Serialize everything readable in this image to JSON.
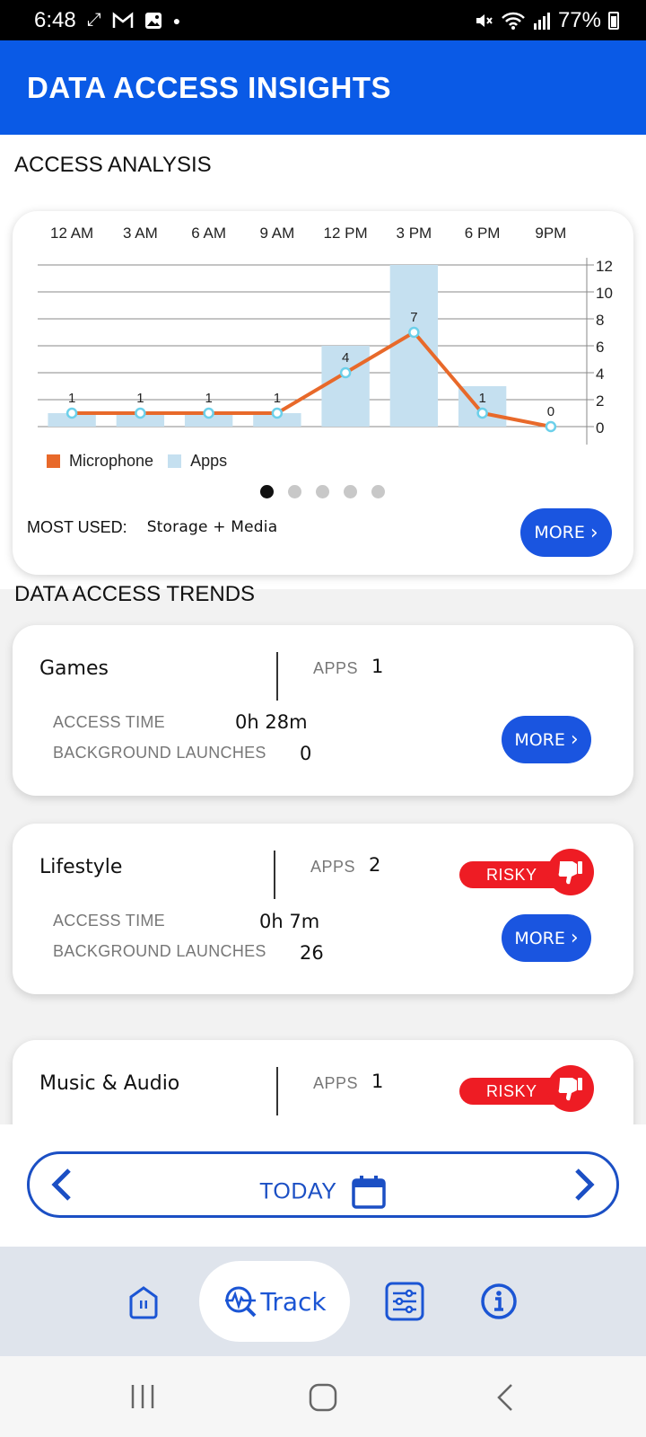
{
  "status_bar": {
    "time": "6:48",
    "battery": "77%",
    "left_icons": [
      "sync-icon",
      "gmail-icon",
      "image-icon",
      "dot-icon"
    ],
    "right_icons": [
      "mute-icon",
      "wifi-icon",
      "signal-icon",
      "battery-icon"
    ]
  },
  "header": {
    "title": "DATA ACCESS INSIGHTS",
    "color": "#0a5ae6"
  },
  "access_analysis": {
    "section_title": "ACCESS ANALYSIS",
    "most_used_label": "MOST USED:",
    "most_used_value": "Storage + Media",
    "more_label": "MORE",
    "legend": [
      {
        "label": "Microphone",
        "color": "#e8692a"
      },
      {
        "label": "Apps",
        "color": "#c5e0f0"
      }
    ],
    "pager": {
      "count": 5,
      "active": 0
    }
  },
  "chart_data": {
    "type": "bar",
    "categories": [
      "12 AM",
      "3 AM",
      "6 AM",
      "9 AM",
      "12 PM",
      "3 PM",
      "6 PM",
      "9PM"
    ],
    "series": [
      {
        "name": "Apps",
        "type": "bar",
        "values": [
          1,
          1,
          1,
          1,
          6,
          12,
          3,
          0
        ]
      },
      {
        "name": "Microphone",
        "type": "line",
        "values": [
          1,
          1,
          1,
          1,
          4,
          7,
          1,
          0
        ]
      }
    ],
    "data_labels": [
      "1",
      "1",
      "1",
      "1",
      "4",
      "7",
      "1",
      "0"
    ],
    "y_ticks": [
      0,
      2,
      4,
      6,
      8,
      10,
      12
    ],
    "ylim": [
      0,
      12
    ],
    "y_axis_position": "right",
    "x_axis_position": "top",
    "grid": true
  },
  "trends": {
    "section_title": "DATA ACCESS TRENDS",
    "apps_label": "APPS",
    "access_time_label": "ACCESS TIME",
    "background_label": "BACKGROUND LAUNCHES",
    "more_label": "MORE",
    "risky_label": "RISKY",
    "items": [
      {
        "category": "Games",
        "apps": "1",
        "access_time": "0h 28m",
        "background_launches": "0",
        "risky": false
      },
      {
        "category": "Lifestyle",
        "apps": "2",
        "access_time": "0h 7m",
        "background_launches": "26",
        "risky": true
      },
      {
        "category": "Music & Audio",
        "apps": "1",
        "risky": true
      }
    ]
  },
  "date_nav": {
    "label": "TODAY"
  },
  "bottom_nav": {
    "active_label": "Track",
    "items": [
      "home-icon",
      "track-icon",
      "filters-icon",
      "info-icon"
    ]
  }
}
